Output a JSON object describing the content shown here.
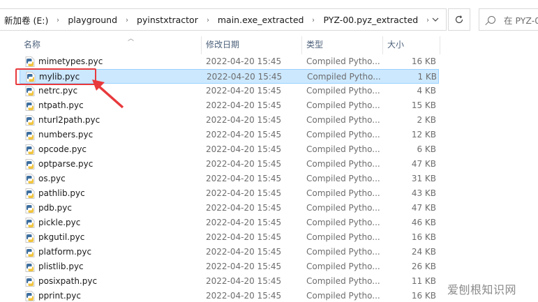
{
  "address_bar": {
    "crumbs": [
      "新加卷 (E:)",
      "playground",
      "pyinstxtractor",
      "main.exe_extracted",
      "PYZ-00.pyz_extracted"
    ],
    "separator": "›"
  },
  "search": {
    "placeholder": "在 PYZ-0"
  },
  "columns": {
    "name": "名称",
    "date": "修改日期",
    "type": "类型",
    "size": "大小"
  },
  "files": [
    {
      "name": "mimetypes.pyc",
      "date": "2022-04-20 15:45",
      "type": "Compiled Pytho...",
      "size": "16 KB"
    },
    {
      "name": "mylib.pyc",
      "date": "2022-04-20 15:45",
      "type": "Compiled Pytho...",
      "size": "1 KB",
      "selected": true
    },
    {
      "name": "netrc.pyc",
      "date": "2022-04-20 15:45",
      "type": "Compiled Pytho...",
      "size": "4 KB"
    },
    {
      "name": "ntpath.pyc",
      "date": "2022-04-20 15:45",
      "type": "Compiled Pytho...",
      "size": "15 KB"
    },
    {
      "name": "nturl2path.pyc",
      "date": "2022-04-20 15:45",
      "type": "Compiled Pytho...",
      "size": "2 KB"
    },
    {
      "name": "numbers.pyc",
      "date": "2022-04-20 15:45",
      "type": "Compiled Pytho...",
      "size": "12 KB"
    },
    {
      "name": "opcode.pyc",
      "date": "2022-04-20 15:45",
      "type": "Compiled Pytho...",
      "size": "6 KB"
    },
    {
      "name": "optparse.pyc",
      "date": "2022-04-20 15:45",
      "type": "Compiled Pytho...",
      "size": "47 KB"
    },
    {
      "name": "os.pyc",
      "date": "2022-04-20 15:45",
      "type": "Compiled Pytho...",
      "size": "31 KB"
    },
    {
      "name": "pathlib.pyc",
      "date": "2022-04-20 15:45",
      "type": "Compiled Pytho...",
      "size": "43 KB"
    },
    {
      "name": "pdb.pyc",
      "date": "2022-04-20 15:45",
      "type": "Compiled Pytho...",
      "size": "47 KB"
    },
    {
      "name": "pickle.pyc",
      "date": "2022-04-20 15:45",
      "type": "Compiled Pytho...",
      "size": "46 KB"
    },
    {
      "name": "pkgutil.pyc",
      "date": "2022-04-20 15:45",
      "type": "Compiled Pytho...",
      "size": "16 KB"
    },
    {
      "name": "platform.pyc",
      "date": "2022-04-20 15:45",
      "type": "Compiled Pytho...",
      "size": "24 KB"
    },
    {
      "name": "plistlib.pyc",
      "date": "2022-04-20 15:45",
      "type": "Compiled Pytho...",
      "size": "26 KB"
    },
    {
      "name": "posixpath.pyc",
      "date": "2022-04-20 15:45",
      "type": "Compiled Pytho...",
      "size": "11 KB"
    },
    {
      "name": "pprint.pyc",
      "date": "2022-04-20 15:45",
      "type": "Compiled Pytho...",
      "size": "16 KB"
    }
  ],
  "watermark": "爱刨根知识网",
  "colors": {
    "selection_bg": "#cce8ff",
    "selection_border": "#99d1ff",
    "highlight": "#e8393c",
    "header_text": "#4c607a"
  },
  "icons": {
    "file": "python-file-icon",
    "refresh": "refresh-icon",
    "search": "search-icon",
    "dropdown": "chevron-down-icon"
  }
}
